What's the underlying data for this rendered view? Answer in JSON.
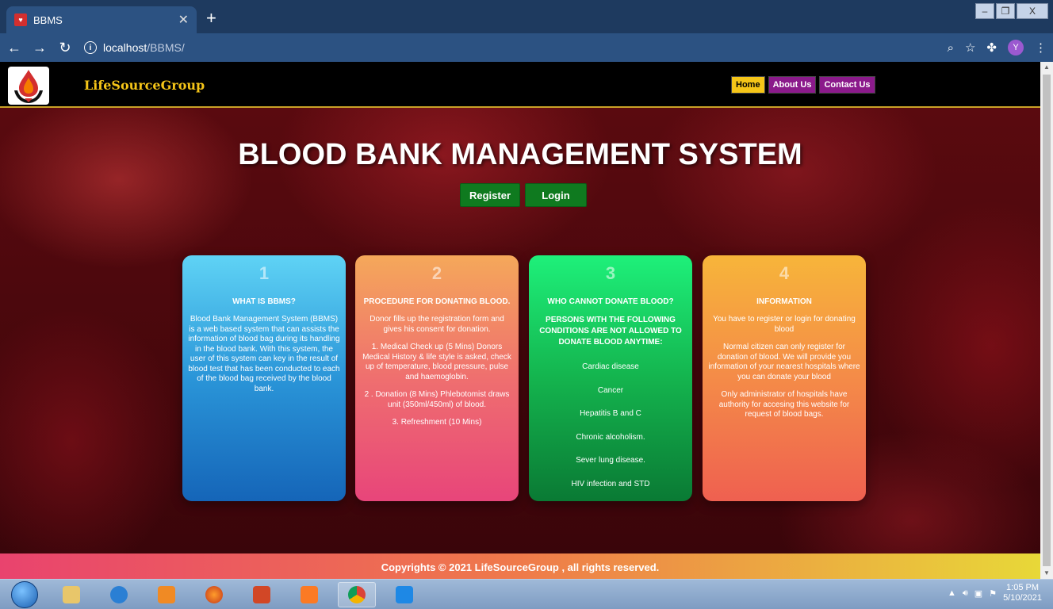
{
  "browser": {
    "tab_title": "BBMS",
    "url_host": "localhost",
    "url_path": "/BBMS/",
    "profile_initial": "Y"
  },
  "site": {
    "brand": "LifeSourceGroup",
    "nav": [
      "Home",
      "About Us",
      "Contact Us"
    ],
    "hero_title": "BLOOD BANK MANAGEMENT SYSTEM",
    "register_label": "Register",
    "login_label": "Login"
  },
  "cards": [
    {
      "number": "1",
      "heading": "WHAT IS BBMS?",
      "body": "Blood Bank Management System (BBMS) is a web based system that can assists the information of blood bag during its handling in the blood bank. With this system, the user of this system can key in the result of blood test that has been conducted to each of the blood bag received by the blood bank."
    },
    {
      "number": "2",
      "heading": "PROCEDURE FOR DONATING BLOOD.",
      "paragraphs": [
        "Donor fills up the registration form and gives his consent for donation.",
        "1. Medical Check up (5 Mins) Donors Medical History & life style is asked, check up of temperature, blood pressure, pulse and haemoglobin.",
        "2 . Donation (8 Mins) Phlebotomist draws unit (350ml/450ml) of blood.",
        "3. Refreshment (10 Mins)"
      ]
    },
    {
      "number": "3",
      "heading": "WHO CANNOT DONATE BLOOD?",
      "subheading": "PERSONS WITH THE FOLLOWING CONDITIONS ARE NOT ALLOWED TO DONATE BLOOD ANYTIME:",
      "conditions": [
        "Cardiac disease",
        "Cancer",
        "Hepatitis B and C",
        "Chronic alcoholism.",
        "Sever lung disease.",
        "HIV infection and STD"
      ]
    },
    {
      "number": "4",
      "heading": "INFORMATION",
      "paragraphs": [
        "You have to register or login for donating blood",
        "Normal citizen can only register for donation of blood. We will provide you information of your nearest hospitals where you can donate your blood",
        "Only administrator of hospitals have authority for accesing this website for request of blood bags."
      ]
    }
  ],
  "footer": "Copyrights © 2021 LifeSourceGroup , all rights reserved.",
  "taskbar": {
    "time": "1:05 PM",
    "date": "5/10/2021"
  },
  "colors": {
    "brand_gold": "#f5c518",
    "nav_purple": "#8b1a8b",
    "cta_green": "#0f7a1f"
  }
}
